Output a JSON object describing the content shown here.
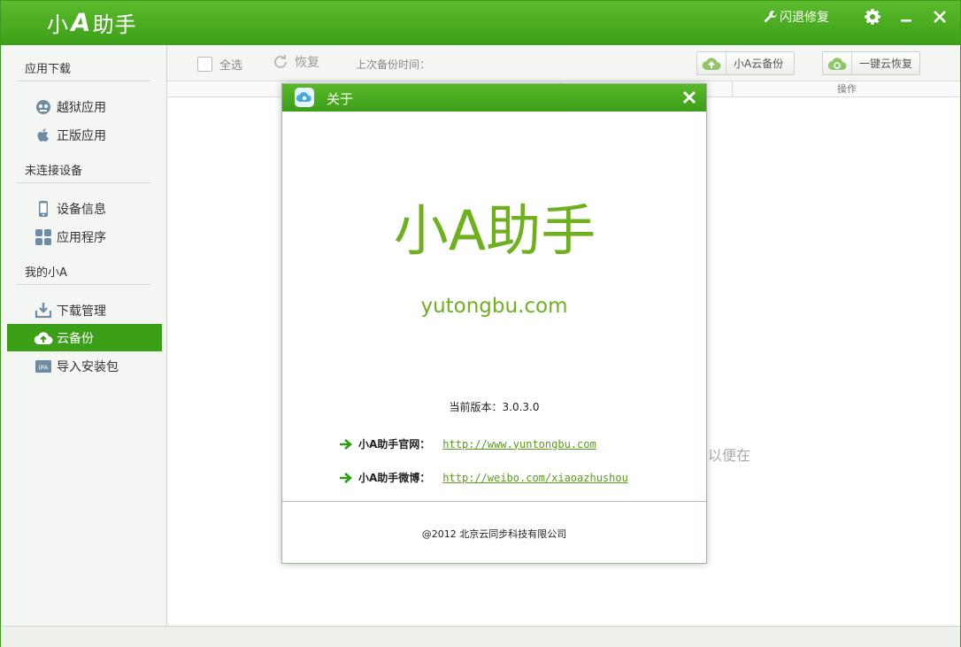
{
  "app": {
    "logo_text": "小",
    "logo_a": "A",
    "logo_rest": "助手",
    "repair_label": "闪退修复",
    "colors": {
      "brand_green": "#3c9f18",
      "link_green": "#5a9c1a",
      "logo_green": "#6fb01f"
    }
  },
  "sidebar": {
    "sections": [
      {
        "title": "应用下载",
        "items": [
          {
            "label": "越狱应用",
            "icon": "jailbreak-apps-icon"
          },
          {
            "label": "正版应用",
            "icon": "apple-icon"
          }
        ]
      },
      {
        "title": "未连接设备",
        "items": [
          {
            "label": "设备信息",
            "icon": "phone-icon"
          },
          {
            "label": "应用程序",
            "icon": "apps-grid-icon"
          }
        ]
      },
      {
        "title": "我的小A",
        "items": [
          {
            "label": "下载管理",
            "icon": "download-icon"
          },
          {
            "label": "云备份",
            "icon": "cloud-upload-icon",
            "active": true
          },
          {
            "label": "导入安装包",
            "icon": "ipa-icon"
          }
        ]
      }
    ]
  },
  "toolbar": {
    "select_all": "全选",
    "restore": "恢复",
    "last_backup": "上次备份时间：",
    "cloud_backup": "小A云备份",
    "cloud_restore": "一键云恢复"
  },
  "table": {
    "col_op": "操作"
  },
  "background_hint": "以便在",
  "about": {
    "title": "关于",
    "logo_text": "小A助手",
    "domain": "yutongbu.com",
    "version_label": "当前版本：3.0.3.0",
    "links": [
      {
        "label": "小A助手官网：",
        "url": "http://www.yuntongbu.com"
      },
      {
        "label": "小A助手微博：",
        "url": "http://weibo.com/xiaoazhushou"
      }
    ],
    "copyright": "@2012 北京云同步科技有限公司"
  }
}
